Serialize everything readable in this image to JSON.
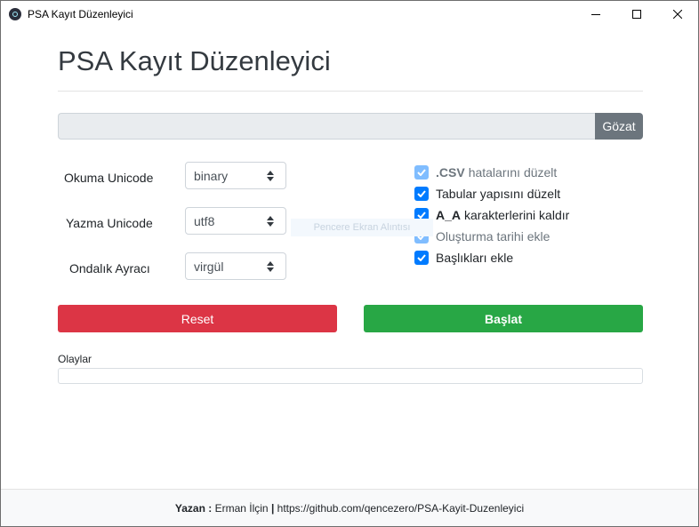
{
  "window": {
    "title": "PSA Kayıt Düzenleyici",
    "icon": "electron-app-icon"
  },
  "header": {
    "title": "PSA Kayıt Düzenleyici"
  },
  "file": {
    "value": "",
    "browse_label": "Gözat"
  },
  "options": {
    "read_unicode": {
      "label": "Okuma Unicode",
      "value": "binary"
    },
    "write_unicode": {
      "label": "Yazma Unicode",
      "value": "utf8"
    },
    "decimal_separator": {
      "label": "Ondalık Ayracı",
      "value": "virgül"
    }
  },
  "checks": [
    {
      "bold": ".CSV",
      "label": "hatalarını düzelt",
      "checked": true,
      "disabled": true
    },
    {
      "bold": "",
      "label": "Tabular yapısını düzelt",
      "checked": true,
      "disabled": false
    },
    {
      "bold": "A_A",
      "label": "karakterlerini kaldır",
      "checked": true,
      "disabled": false
    },
    {
      "bold": "",
      "label": "Oluşturma tarihi ekle",
      "checked": true,
      "disabled": true
    },
    {
      "bold": "",
      "label": "Başlıkları ekle",
      "checked": true,
      "disabled": false
    }
  ],
  "overlay_text": "Pencere Ekran Alıntısı",
  "actions": {
    "reset_label": "Reset",
    "start_label": "Başlat"
  },
  "events": {
    "label": "Olaylar",
    "value": ""
  },
  "footer": {
    "author_label": "Yazan :",
    "author_name": "Erman İlçin",
    "separator": "|",
    "repo": "https://github.com/qencezero/PSA-Kayit-Duzenleyici"
  },
  "colors": {
    "danger": "#dc3545",
    "success": "#28a745",
    "primary": "#007bff",
    "secondary": "#6c757d"
  }
}
